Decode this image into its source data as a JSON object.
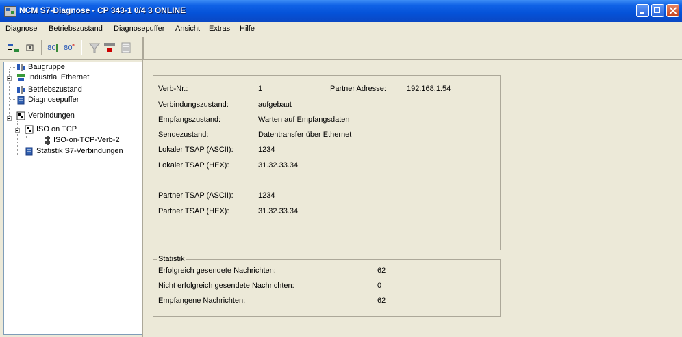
{
  "window": {
    "title": "NCM S7-Diagnose - CP 343-1 0/4 3  ONLINE"
  },
  "menu": [
    "Diagnose",
    "Betriebszustand",
    "Diagnosepuffer",
    "Ansicht",
    "Extras",
    "Hilfe"
  ],
  "toolbar": {
    "icons": [
      "connect-icon",
      "disconnect-icon",
      "module-info-icon",
      "module-info2-icon",
      "filter-icon",
      "ethernet-icon",
      "help-icon"
    ]
  },
  "tree": {
    "items": [
      {
        "label": "Baugruppe",
        "icon": "module-icon"
      },
      {
        "label": "Industrial Ethernet",
        "icon": "network-icon"
      },
      {
        "label": "Betriebszustand",
        "icon": "operating-state-icon"
      },
      {
        "label": "Diagnosepuffer",
        "icon": "buffer-icon"
      },
      {
        "label": "Verbindungen",
        "icon": "connections-icon"
      },
      {
        "label": "ISO on TCP",
        "icon": "connections-icon"
      },
      {
        "label": "ISO-on-TCP-Verb-2",
        "icon": "connection-leaf-icon"
      },
      {
        "label": "Statistik S7-Verbindungen",
        "icon": "statistics-icon"
      }
    ]
  },
  "details": {
    "verb_nr_label": "Verb-Nr.:",
    "verb_nr_value": "1",
    "partner_addr_label": "Partner Adresse:",
    "partner_addr_value": "192.168.1.54",
    "verbindungszustand_label": "Verbindungszustand:",
    "verbindungszustand_value": "aufgebaut",
    "empfangszustand_label": "Empfangszustand:",
    "empfangszustand_value": "Warten auf Empfangsdaten",
    "sendezustand_label": "Sendezustand:",
    "sendezustand_value": "Datentransfer über Ethernet",
    "lokaler_tsap_ascii_label": "Lokaler TSAP (ASCII):",
    "lokaler_tsap_ascii_value": "1234",
    "lokaler_tsap_hex_label": "Lokaler TSAP (HEX):",
    "lokaler_tsap_hex_value": "31.32.33.34",
    "partner_tsap_ascii_label": "Partner TSAP (ASCII):",
    "partner_tsap_ascii_value": "1234",
    "partner_tsap_hex_label": "Partner TSAP (HEX):",
    "partner_tsap_hex_value": "31.32.33.34"
  },
  "statistik": {
    "title": "Statistik",
    "rows": [
      {
        "label": "Erfolgreich gesendete Nachrichten:",
        "value": "62"
      },
      {
        "label": "Nicht erfolgreich gesendete Nachrichten:",
        "value": "0"
      },
      {
        "label": "Empfangene Nachrichten:",
        "value": "62"
      }
    ]
  }
}
